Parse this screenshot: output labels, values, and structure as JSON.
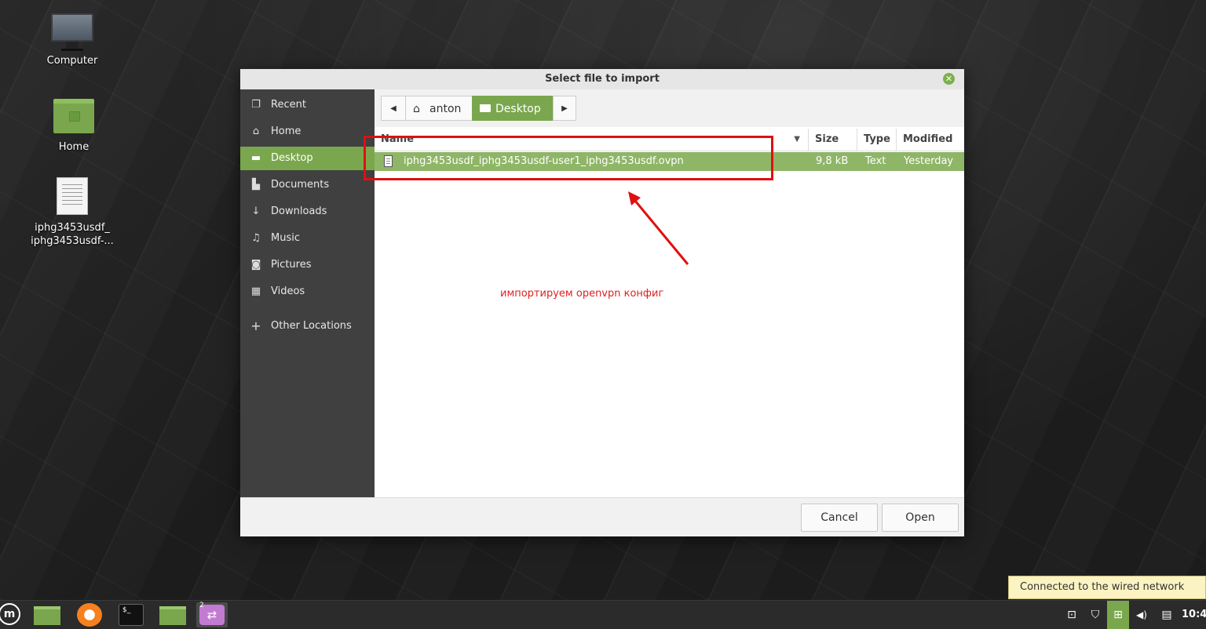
{
  "desktop": {
    "icons": [
      {
        "label": "Computer",
        "icon": "computer-icon"
      },
      {
        "label": "Home",
        "icon": "home-folder-icon"
      },
      {
        "label_line1": "iphg3453usdf_",
        "label_line2": "iphg3453usdf-...",
        "icon": "text-file-icon"
      }
    ]
  },
  "dialog": {
    "title": "Select file to import",
    "sidebar": [
      {
        "label": "Recent",
        "icon": "recent-icon"
      },
      {
        "label": "Home",
        "icon": "home-icon"
      },
      {
        "label": "Desktop",
        "icon": "desktop-icon",
        "active": true
      },
      {
        "label": "Documents",
        "icon": "documents-icon"
      },
      {
        "label": "Downloads",
        "icon": "downloads-icon"
      },
      {
        "label": "Music",
        "icon": "music-icon"
      },
      {
        "label": "Pictures",
        "icon": "pictures-icon"
      },
      {
        "label": "Videos",
        "icon": "videos-icon"
      },
      {
        "label": "Other Locations",
        "icon": "plus-icon"
      }
    ],
    "path": {
      "segments": [
        "anton",
        "Desktop"
      ],
      "active": "Desktop"
    },
    "columns": {
      "name": "Name",
      "size": "Size",
      "type": "Type",
      "modified": "Modified"
    },
    "files": [
      {
        "name": "iphg3453usdf_iphg3453usdf-user1_iphg3453usdf.ovpn",
        "size": "9,8 kB",
        "type": "Text",
        "modified": "Yesterday",
        "selected": true
      }
    ],
    "buttons": {
      "cancel": "Cancel",
      "open": "Open"
    }
  },
  "annotation": {
    "text": "импортируем openvpn конфиг",
    "color": "#e02020"
  },
  "tooltip": "Connected to the wired network",
  "taskbar": {
    "clock": "10:4",
    "workspace_badge": "2"
  },
  "colors": {
    "accent": "#7aa74d",
    "sidebar": "#404040"
  }
}
